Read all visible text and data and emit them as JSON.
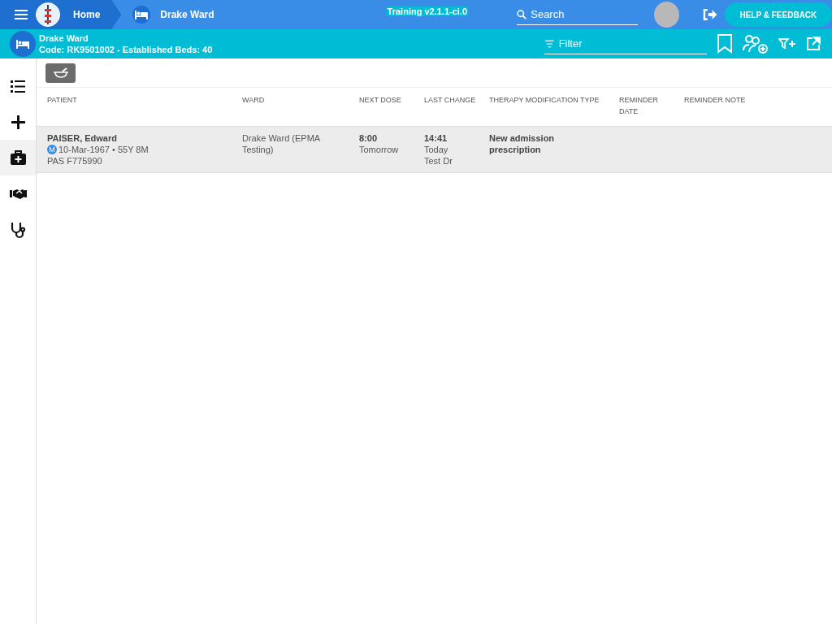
{
  "topbar": {
    "home": "Home",
    "ward": "Drake Ward",
    "version": "Training v2.1.1-ci.0",
    "search": {
      "placeholder": "Search"
    },
    "help": "HELP & FEEDBACK"
  },
  "subbar": {
    "title": "Drake Ward",
    "subtitle": "Code: RK9501002 - Established Beds: 40",
    "filter": {
      "placeholder": "Filter"
    }
  },
  "sidebar": {
    "items": [
      {
        "kind": "list",
        "selected": false
      },
      {
        "kind": "add",
        "selected": false
      },
      {
        "kind": "medkit",
        "selected": true
      },
      {
        "kind": "handshake",
        "selected": false
      },
      {
        "kind": "stethoscope",
        "selected": false
      }
    ]
  },
  "table": {
    "columns": [
      "PATIENT",
      "WARD",
      "NEXT DOSE",
      "LAST CHANGE",
      "THERAPY MODIFICATION TYPE",
      "REMINDER DATE",
      "REMINDER NOTE"
    ],
    "rows": [
      {
        "name": "PAISER, Edward",
        "sex": "M",
        "dob": "10-Mar-1967 • 55Y 8M",
        "pas": "PAS F775990",
        "ward": "Drake Ward (EPMA Testing)",
        "dose_time": "8:00",
        "dose_day": "Tomorrow",
        "change_time": "14:41",
        "change_day": "Today",
        "change_by": "Test Dr",
        "therapy": "New admission prescription",
        "selected": true
      }
    ]
  }
}
